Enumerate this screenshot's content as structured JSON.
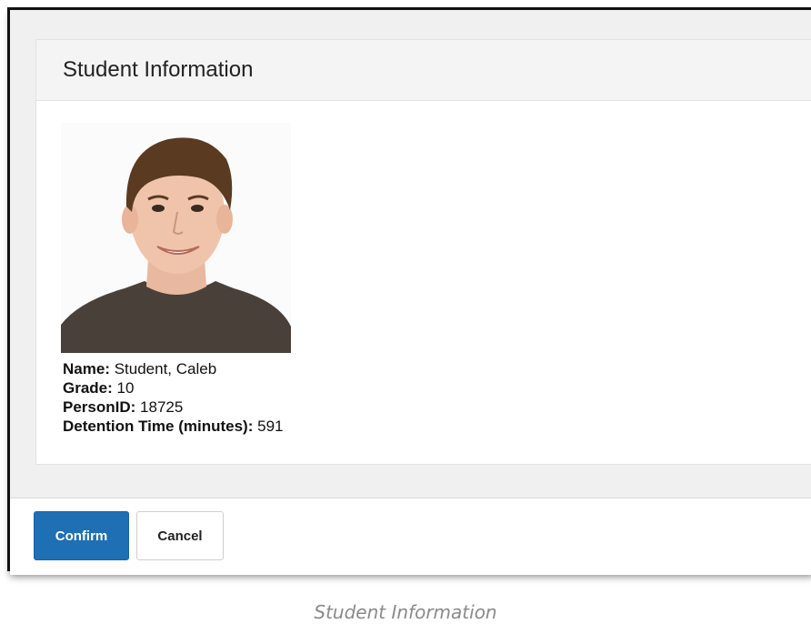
{
  "dialog": {
    "title": "Student Information",
    "photo_icon": "student-photo",
    "fields": [
      {
        "label": "Name:",
        "value": "Student, Caleb"
      },
      {
        "label": "Grade:",
        "value": "10"
      },
      {
        "label": "PersonID:",
        "value": "18725"
      },
      {
        "label": "Detention Time (minutes):",
        "value": "591"
      }
    ]
  },
  "footer": {
    "confirm_label": "Confirm",
    "cancel_label": "Cancel"
  },
  "caption": "Student Information",
  "colors": {
    "primary_button": "#1f6fb5",
    "header_bg": "#f4f4f4",
    "caption": "#8a8a8a"
  }
}
